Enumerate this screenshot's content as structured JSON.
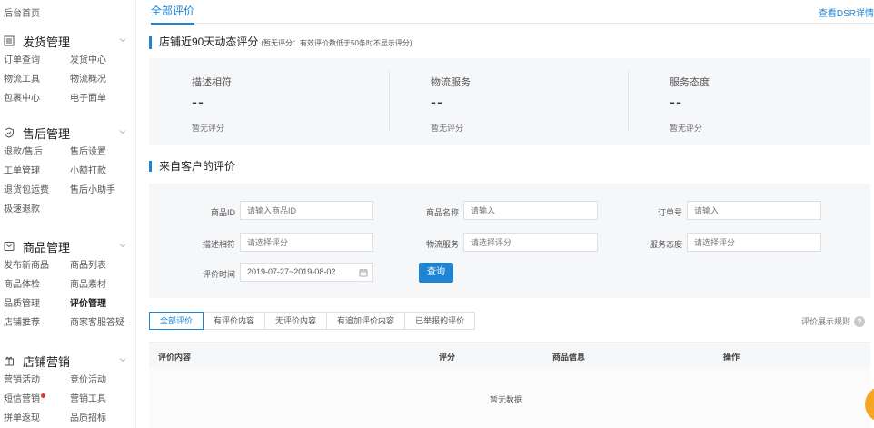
{
  "sidebar": {
    "home": "后台首页",
    "groups": [
      {
        "title": "发货管理",
        "icon": "list-icon",
        "items": [
          "订单查询",
          "发货中心",
          "物流工具",
          "物流概况",
          "包裹中心",
          "电子面单"
        ]
      },
      {
        "title": "售后管理",
        "icon": "shield-check-icon",
        "items": [
          "退款/售后",
          "售后设置",
          "工单管理",
          "小额打款",
          "退货包运费",
          "售后小助手",
          "极速退款"
        ]
      },
      {
        "title": "商品管理",
        "icon": "box-icon",
        "items": [
          "发布新商品",
          "商品列表",
          "商品体检",
          "商品素材",
          "品质管理",
          "评价管理",
          "店铺推荐",
          "商家客服答疑"
        ]
      },
      {
        "title": "店铺营销",
        "icon": "gift-icon",
        "items": [
          "营销活动",
          "竞价活动",
          "短信营销",
          "营销工具",
          "拼单返现",
          "品质招标"
        ]
      }
    ],
    "active_item": "评价管理"
  },
  "header": {
    "tab": "全部评价",
    "dsr_link": "查看DSR详情"
  },
  "dsr": {
    "title": "店铺近90天动态评分",
    "note": "(暂无评分：有效评价数低于50条时不显示评分)",
    "metrics": [
      {
        "label": "描述相符",
        "value": "--",
        "sub": "暂无评分"
      },
      {
        "label": "物流服务",
        "value": "--",
        "sub": "暂无评分"
      },
      {
        "label": "服务态度",
        "value": "--",
        "sub": "暂无评分"
      }
    ]
  },
  "reviews": {
    "title": "来自客户的评价",
    "filters": {
      "product_id_label": "商品ID",
      "product_id_placeholder": "请输入商品ID",
      "product_name_label": "商品名称",
      "product_name_placeholder": "请输入",
      "order_no_label": "订单号",
      "order_no_placeholder": "请输入",
      "desc_label": "描述相符",
      "desc_placeholder": "请选择评分",
      "logistics_label": "物流服务",
      "logistics_placeholder": "请选择评分",
      "service_label": "服务态度",
      "service_placeholder": "请选择评分",
      "time_label": "评价时间",
      "time_value": "2019-07-27~2019-08-02",
      "query_button": "查询"
    },
    "tabs": [
      "全部评价",
      "有评价内容",
      "无评价内容",
      "有追加评价内容",
      "已举报的评价"
    ],
    "active_tab": 0,
    "rules_link": "评价展示规则",
    "columns": [
      "评价内容",
      "评分",
      "商品信息",
      "操作"
    ],
    "empty_text": "暂无数据"
  }
}
